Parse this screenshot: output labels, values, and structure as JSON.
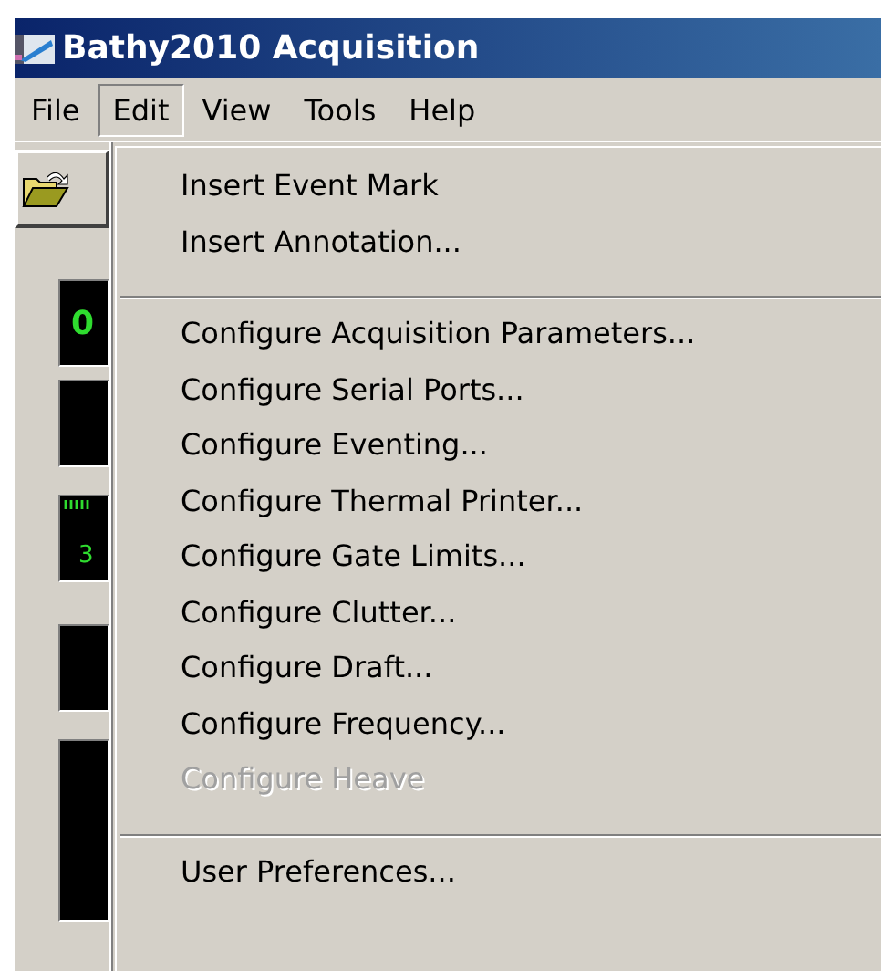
{
  "window": {
    "title": "Bathy2010 Acquisition"
  },
  "menu_bar": [
    {
      "label": "File",
      "selected": false
    },
    {
      "label": "Edit",
      "selected": true
    },
    {
      "label": "View",
      "selected": false
    },
    {
      "label": "Tools",
      "selected": false
    },
    {
      "label": "Help",
      "selected": false
    }
  ],
  "displays": [
    {
      "kind": "digit",
      "text": "0"
    },
    {
      "kind": "blank"
    },
    {
      "kind": "gauge",
      "text": "3"
    },
    {
      "kind": "blank"
    },
    {
      "kind": "tall"
    }
  ],
  "edit_menu": {
    "groups": [
      [
        {
          "label": "Insert Event Mark",
          "disabled": false
        },
        {
          "label": "Insert Annotation...",
          "disabled": false
        }
      ],
      [
        {
          "label": "Configure Acquisition Parameters...",
          "disabled": false
        },
        {
          "label": "Configure Serial Ports...",
          "disabled": false
        },
        {
          "label": "Configure Eventing...",
          "disabled": false
        },
        {
          "label": "Configure Thermal Printer...",
          "disabled": false
        },
        {
          "label": "Configure Gate Limits...",
          "disabled": false
        },
        {
          "label": "Configure Clutter...",
          "disabled": false
        },
        {
          "label": "Configure Draft...",
          "disabled": false
        },
        {
          "label": "Configure Frequency...",
          "disabled": false
        },
        {
          "label": "Configure Heave",
          "disabled": true
        }
      ],
      [
        {
          "label": "User Preferences...",
          "disabled": false
        }
      ]
    ]
  }
}
